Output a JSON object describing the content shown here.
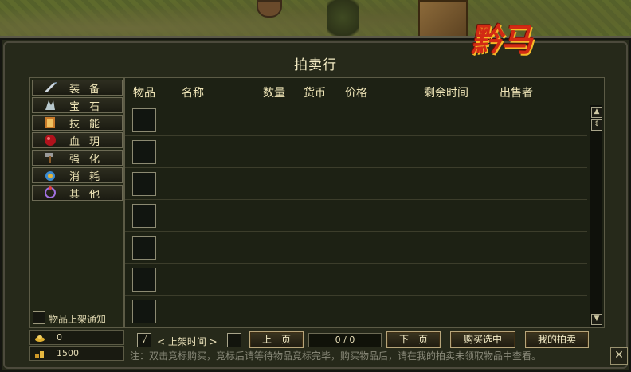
{
  "window": {
    "title": "拍卖行",
    "logo_text": "黔马",
    "close_label": "✕"
  },
  "categories": [
    {
      "label": "装备",
      "icon": "sword-icon"
    },
    {
      "label": "宝石",
      "icon": "gem-icon"
    },
    {
      "label": "技能",
      "icon": "book-icon"
    },
    {
      "label": "血玥",
      "icon": "blood-orb-icon"
    },
    {
      "label": "强化",
      "icon": "hammer-icon"
    },
    {
      "label": "消耗",
      "icon": "potion-icon"
    },
    {
      "label": "其他",
      "icon": "ring-icon"
    }
  ],
  "notify": {
    "label": "物品上架通知",
    "checked": false
  },
  "currency": {
    "gold": "0",
    "coins": "1500"
  },
  "table": {
    "columns": [
      "物品",
      "名称",
      "数量",
      "货币",
      "价格",
      "剩余时间",
      "出售者"
    ],
    "rows": [
      {},
      {},
      {},
      {},
      {},
      {},
      {}
    ]
  },
  "bottom": {
    "sort_checkbox": "√",
    "sort_label": "< 上架时间 >",
    "prev_label": "上一页",
    "page_indicator": "0 / 0",
    "next_label": "下一页",
    "buy_label": "购买选中",
    "my_auction_label": "我的拍卖",
    "note": "注：双击竞标购买，竞标后请等待物品竞标完毕，购买物品后，请在我的拍卖未领取物品中查看。"
  },
  "colors": {
    "logo": "#d22a14",
    "panel": "#1d2114",
    "accent_text": "#f0e6b8"
  }
}
